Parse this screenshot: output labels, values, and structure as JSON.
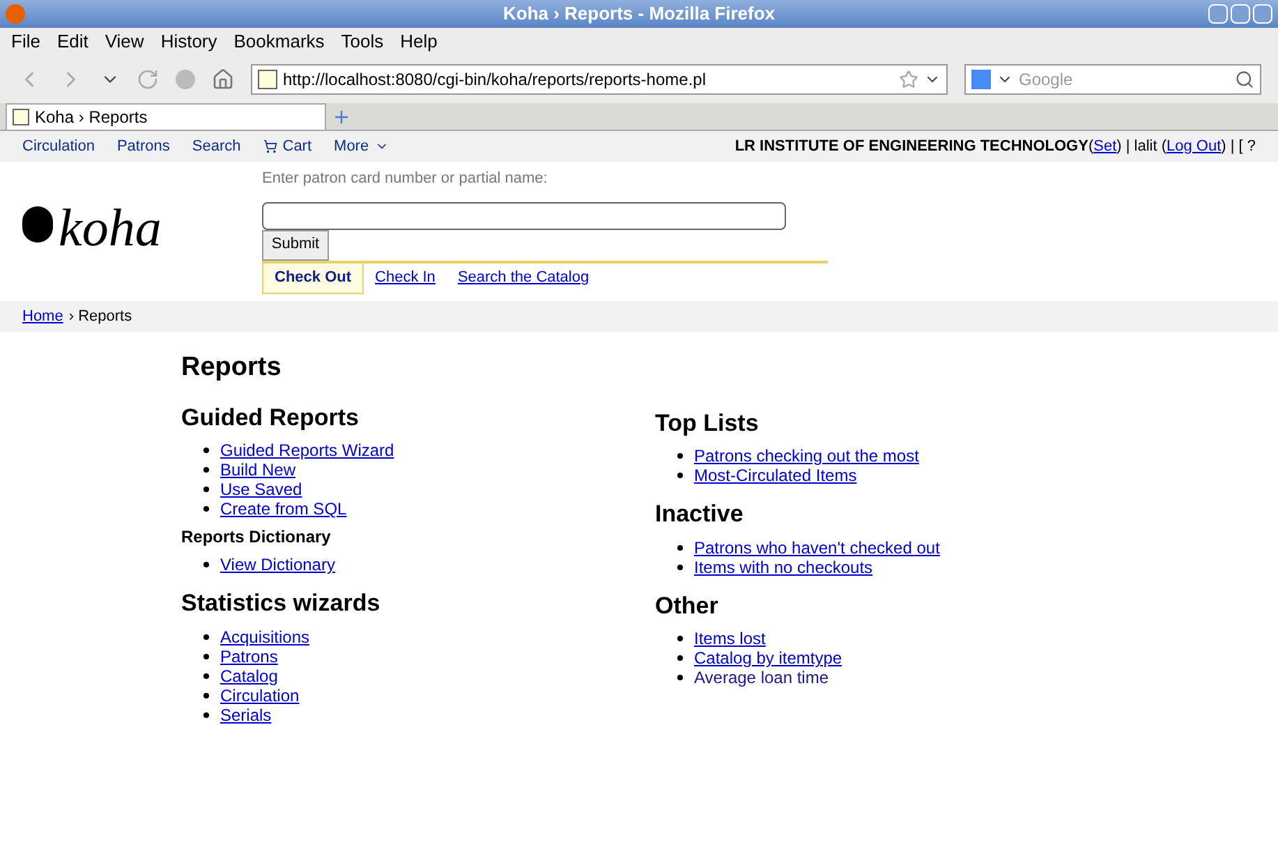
{
  "window": {
    "title": "Koha › Reports - Mozilla Firefox"
  },
  "menu": [
    "File",
    "Edit",
    "View",
    "History",
    "Bookmarks",
    "Tools",
    "Help"
  ],
  "url": "http://localhost:8080/cgi-bin/koha/reports/reports-home.pl",
  "search_engine": {
    "placeholder": "Google"
  },
  "browser_tabs": [
    {
      "label": "Koha › Reports",
      "selected": true
    }
  ],
  "koha_nav": [
    "Circulation",
    "Patrons",
    "Search",
    "Cart",
    "More"
  ],
  "login_bar": [
    {
      "kind": "bold",
      "text": "LR INSTITUTE OF ENGINEERING TECHNOLOGY"
    },
    {
      "kind": "text",
      "text": "("
    },
    {
      "kind": "link",
      "text": "Set"
    },
    {
      "kind": "text",
      "text": ") | lalit ("
    },
    {
      "kind": "link",
      "text": "Log Out"
    },
    {
      "kind": "text",
      "text": ") | [ ?"
    }
  ],
  "checkout": {
    "label": "Enter patron card number or partial name:",
    "button": "Submit"
  },
  "circ_tabs": [
    {
      "label": "Check Out",
      "selected": true
    },
    {
      "label": "Check In",
      "selected": false
    },
    {
      "label": "Search the Catalog",
      "selected": false
    }
  ],
  "breadcrumb": [
    {
      "kind": "link",
      "text": "Home"
    },
    {
      "kind": "text",
      "text": "› Reports"
    }
  ],
  "logo": "koha",
  "page_title": "Reports",
  "columns": [
    [
      {
        "kind": "heading",
        "text": "Guided Reports",
        "items": [
          {
            "kind": "link",
            "text": "Guided Reports Wizard"
          },
          {
            "kind": "link",
            "text": "Build New"
          },
          {
            "kind": "link",
            "text": "Use Saved"
          },
          {
            "kind": "link",
            "text": "Create from SQL"
          }
        ]
      },
      {
        "kind": "subheading",
        "text": "Reports Dictionary",
        "items": [
          {
            "kind": "link",
            "text": "View Dictionary"
          }
        ]
      },
      {
        "kind": "heading",
        "text": "Statistics wizards",
        "items": [
          {
            "kind": "link",
            "text": "Acquisitions"
          },
          {
            "kind": "link",
            "text": "Patrons"
          },
          {
            "kind": "link",
            "text": "Catalog"
          },
          {
            "kind": "link",
            "text": "Circulation"
          },
          {
            "kind": "link",
            "text": "Serials"
          }
        ]
      }
    ],
    [
      {
        "kind": "heading",
        "text": "Top Lists",
        "items": [
          {
            "kind": "link",
            "text": "Patrons checking out the most"
          },
          {
            "kind": "link",
            "text": "Most-Circulated Items"
          }
        ]
      },
      {
        "kind": "heading",
        "text": "Inactive",
        "items": [
          {
            "kind": "link",
            "text": "Patrons who haven't checked out"
          },
          {
            "kind": "link",
            "text": "Items with no checkouts"
          }
        ]
      },
      {
        "kind": "heading",
        "text": "Other",
        "items": [
          {
            "kind": "link",
            "text": "Items lost"
          },
          {
            "kind": "link",
            "text": "Catalog by itemtype"
          },
          {
            "kind": "text",
            "text": "Average loan time"
          }
        ]
      }
    ]
  ]
}
